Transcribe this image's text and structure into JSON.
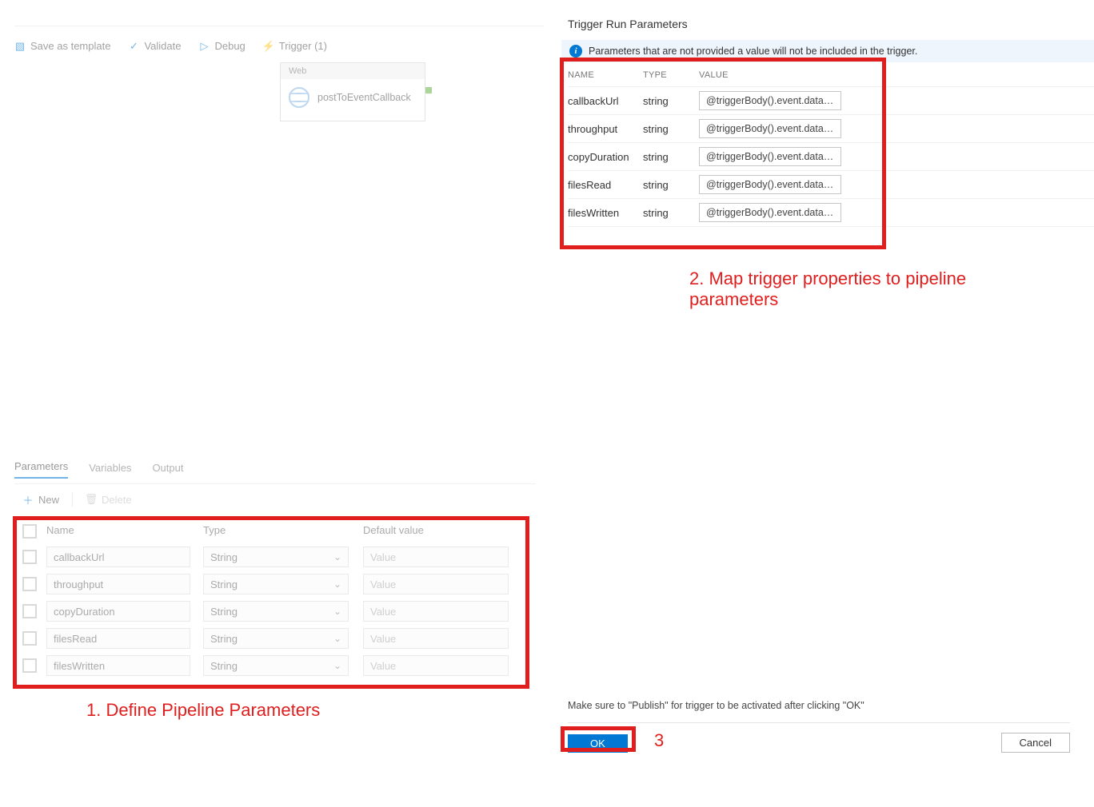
{
  "toolbar": {
    "save_template": "Save as template",
    "validate": "Validate",
    "debug": "Debug",
    "trigger": "Trigger (1)"
  },
  "activity": {
    "type_label": "Web",
    "name": "postToEventCallback"
  },
  "bottom_tabs": {
    "parameters": "Parameters",
    "variables": "Variables",
    "output": "Output"
  },
  "param_toolbar": {
    "new": "New",
    "delete": "Delete"
  },
  "param_headers": {
    "name": "Name",
    "type": "Type",
    "default": "Default value"
  },
  "param_rows": [
    {
      "name": "callbackUrl",
      "type": "String",
      "default_ph": "Value"
    },
    {
      "name": "throughput",
      "type": "String",
      "default_ph": "Value"
    },
    {
      "name": "copyDuration",
      "type": "String",
      "default_ph": "Value"
    },
    {
      "name": "filesRead",
      "type": "String",
      "default_ph": "Value"
    },
    {
      "name": "filesWritten",
      "type": "String",
      "default_ph": "Value"
    }
  ],
  "panel": {
    "title": "Trigger Run Parameters",
    "banner": "Parameters that are not provided a value will not be included in the trigger.",
    "headers": {
      "name": "NAME",
      "type": "TYPE",
      "value": "VALUE"
    },
    "rows": [
      {
        "name": "callbackUrl",
        "type": "string",
        "value": "@triggerBody().event.data.ca..."
      },
      {
        "name": "throughput",
        "type": "string",
        "value": "@triggerBody().event.data.th..."
      },
      {
        "name": "copyDuration",
        "type": "string",
        "value": "@triggerBody().event.data.co..."
      },
      {
        "name": "filesRead",
        "type": "string",
        "value": "@triggerBody().event.data.fil..."
      },
      {
        "name": "filesWritten",
        "type": "string",
        "value": "@triggerBody().event.data.fil..."
      }
    ],
    "publish_note": "Make sure to \"Publish\" for trigger to be activated after clicking \"OK\"",
    "ok": "OK",
    "cancel": "Cancel"
  },
  "annotations": {
    "a1": "1. Define Pipeline Parameters",
    "a2": "2. Map trigger properties to pipeline parameters",
    "a3": "3"
  }
}
